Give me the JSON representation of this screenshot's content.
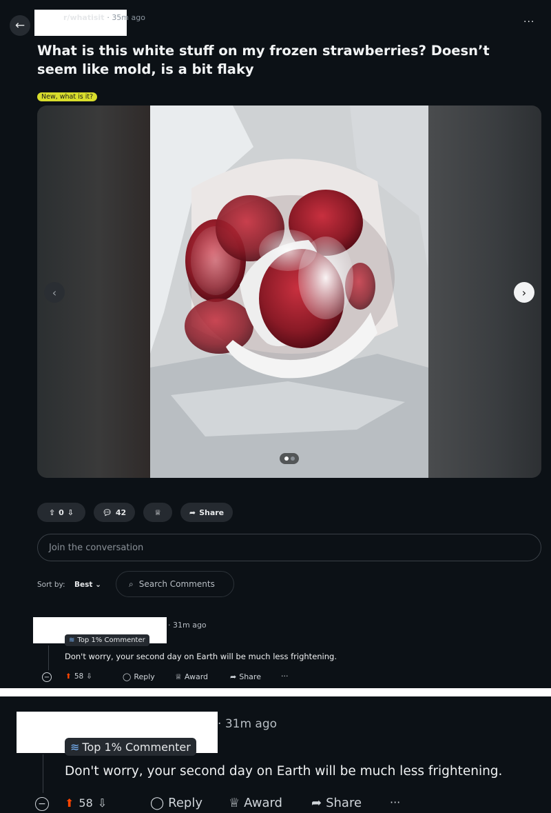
{
  "post": {
    "subreddit": "r/whatisit",
    "age": "35m ago",
    "menu_glyph": "···",
    "title": "What is this white stuff on my frozen strawberries? Doesn’t seem like mold, is a bit flaky",
    "flair": "New, what is it?",
    "gallery": {
      "current": 1,
      "total": 2
    },
    "votes": "0",
    "comments": "42",
    "share_label": "Share"
  },
  "composer": {
    "placeholder": "Join the conversation"
  },
  "sort": {
    "label": "Sort by:",
    "value": "Best"
  },
  "search": {
    "placeholder": "Search Comments"
  },
  "comment": {
    "age": "31m ago",
    "badge": "Top 1% Commenter",
    "body": "Don't worry, your second day on Earth will be much less frightening.",
    "votes": "58",
    "reply_label": "Reply",
    "award_label": "Award",
    "share_label": "Share",
    "more_glyph": "···"
  },
  "colors": {
    "background": "#0c1116",
    "flair": "#d8dd2c",
    "upvote": "#ff4500",
    "pill": "#252a30"
  }
}
